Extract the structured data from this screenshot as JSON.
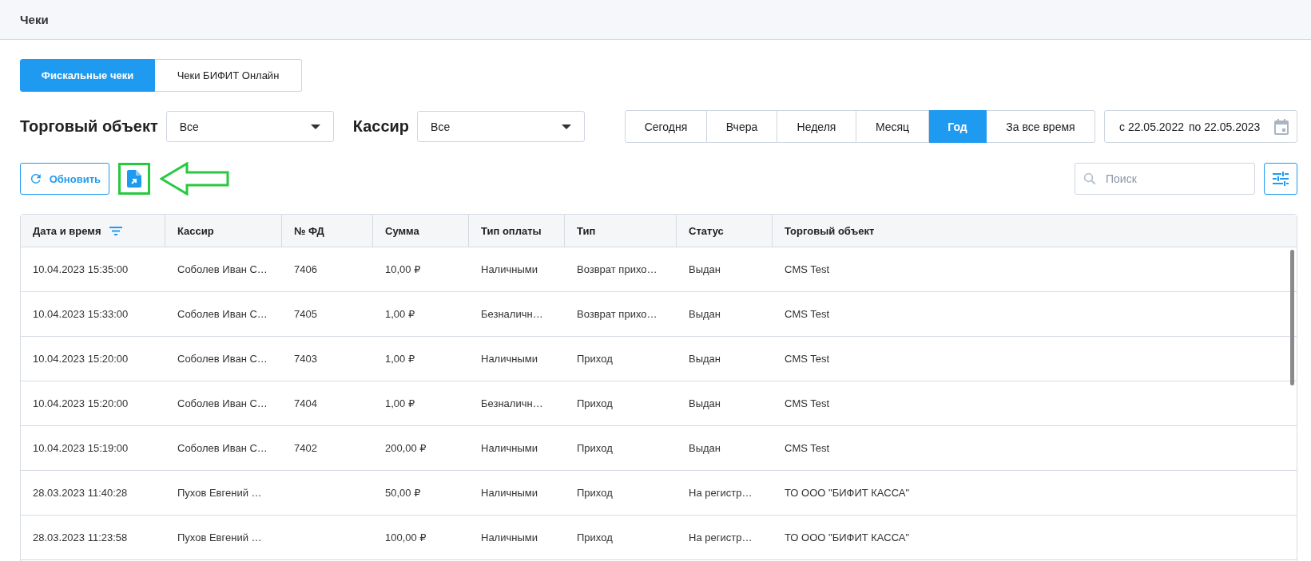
{
  "page_title": "Чеки",
  "tabs": [
    {
      "label": "Фискальные чеки",
      "selected": true
    },
    {
      "label": "Чеки БИФИТ Онлайн",
      "selected": false
    }
  ],
  "filters": [
    {
      "label": "Торговый объект",
      "value": "Все"
    },
    {
      "label": "Кассир",
      "value": "Все"
    }
  ],
  "periods": [
    {
      "label": "Сегодня",
      "selected": false
    },
    {
      "label": "Вчера",
      "selected": false
    },
    {
      "label": "Неделя",
      "selected": false
    },
    {
      "label": "Месяц",
      "selected": false
    },
    {
      "label": "Год",
      "selected": true
    },
    {
      "label": "За все время",
      "selected": false
    }
  ],
  "date_range": {
    "from": "с 22.05.2022",
    "to": "по 22.05.2023"
  },
  "refresh_button": "Обновить",
  "search": {
    "placeholder": "Поиск"
  },
  "table": {
    "columns": [
      {
        "label": "Дата и время",
        "sorted": true
      },
      {
        "label": "Кассир",
        "sorted": false
      },
      {
        "label": "№ ФД",
        "sorted": false
      },
      {
        "label": "Сумма",
        "sorted": false
      },
      {
        "label": "Тип оплаты",
        "sorted": false
      },
      {
        "label": "Тип",
        "sorted": false
      },
      {
        "label": "Статус",
        "sorted": false
      },
      {
        "label": "Торговый объект",
        "sorted": false
      }
    ],
    "rows": [
      [
        "10.04.2023 15:35:00",
        "Соболев Иван С…",
        "7406",
        "10,00 ₽",
        "Наличными",
        "Возврат прихо…",
        "Выдан",
        "CMS Test"
      ],
      [
        "10.04.2023 15:33:00",
        "Соболев Иван С…",
        "7405",
        "1,00 ₽",
        "Безналичн…",
        "Возврат прихо…",
        "Выдан",
        "CMS Test"
      ],
      [
        "10.04.2023 15:20:00",
        "Соболев Иван С…",
        "7403",
        "1,00 ₽",
        "Наличными",
        "Приход",
        "Выдан",
        "CMS Test"
      ],
      [
        "10.04.2023 15:20:00",
        "Соболев Иван С…",
        "7404",
        "1,00 ₽",
        "Безналичн…",
        "Приход",
        "Выдан",
        "CMS Test"
      ],
      [
        "10.04.2023 15:19:00",
        "Соболев Иван С…",
        "7402",
        "200,00 ₽",
        "Наличными",
        "Приход",
        "Выдан",
        "CMS Test"
      ],
      [
        "28.03.2023 11:40:28",
        "Пухов Евгений …",
        null,
        "50,00 ₽",
        "Наличными",
        "Приход",
        "На регистр…",
        "ТО ООО \"БИФИТ КАССА\""
      ],
      [
        "28.03.2023 11:23:58",
        "Пухов Евгений …",
        null,
        "100,00 ₽",
        "Наличными",
        "Приход",
        "На регистр…",
        "ТО ООО \"БИФИТ КАССА\""
      ]
    ]
  }
}
